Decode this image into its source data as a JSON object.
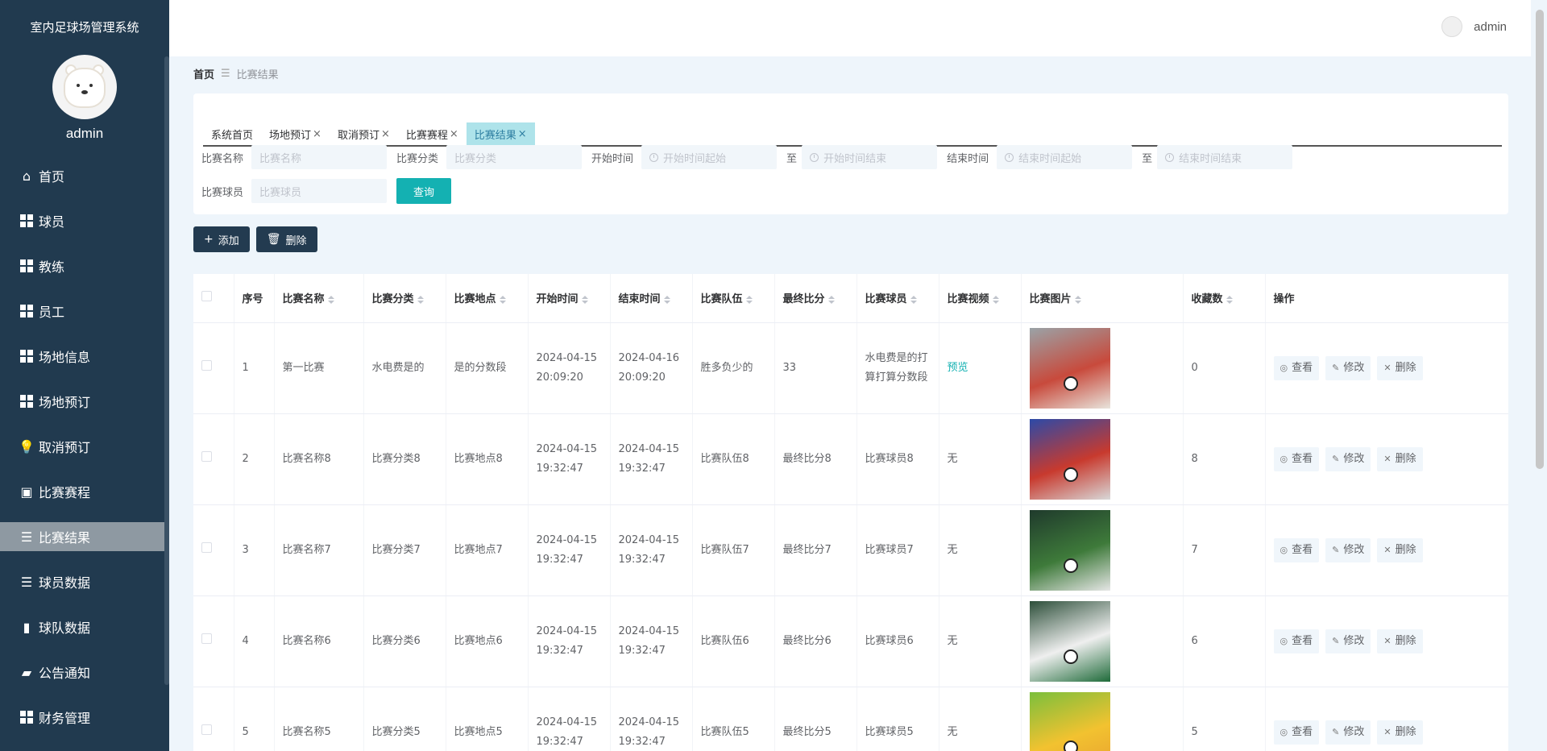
{
  "app": {
    "title": "室内足球场管理系统",
    "user": "admin"
  },
  "topbar": {
    "user": "admin"
  },
  "sidebar": {
    "items": [
      {
        "label": "首页",
        "icon": "home-icon"
      },
      {
        "label": "球员",
        "icon": "grid-icon"
      },
      {
        "label": "教练",
        "icon": "grid-icon"
      },
      {
        "label": "员工",
        "icon": "grid-icon"
      },
      {
        "label": "场地信息",
        "icon": "grid-icon"
      },
      {
        "label": "场地预订",
        "icon": "grid-icon"
      },
      {
        "label": "取消预订",
        "icon": "bulb-icon"
      },
      {
        "label": "比赛赛程",
        "icon": "wallet-icon"
      },
      {
        "label": "比赛结果",
        "icon": "sliders-icon",
        "active": true
      },
      {
        "label": "球员数据",
        "icon": "list-icon"
      },
      {
        "label": "球队数据",
        "icon": "bar-chart-icon"
      },
      {
        "label": "公告通知",
        "icon": "ticket-icon"
      },
      {
        "label": "财务管理",
        "icon": "grid-icon"
      }
    ]
  },
  "breadcrumb": {
    "home": "首页",
    "separator": "☰",
    "current": "比赛结果"
  },
  "tabs": [
    {
      "label": "系统首页",
      "closable": false
    },
    {
      "label": "场地预订",
      "closable": true
    },
    {
      "label": "取消预订",
      "closable": true
    },
    {
      "label": "比赛赛程",
      "closable": true
    },
    {
      "label": "比赛结果",
      "closable": true,
      "active": true
    }
  ],
  "filters": {
    "name_label": "比赛名称",
    "name_placeholder": "比赛名称",
    "category_label": "比赛分类",
    "category_placeholder": "比赛分类",
    "start_label": "开始时间",
    "start_from_placeholder": "开始时间起始",
    "start_to_placeholder": "开始时间结束",
    "end_label": "结束时间",
    "end_from_placeholder": "结束时间起始",
    "end_to_placeholder": "结束时间结束",
    "to": "至",
    "player_label": "比赛球员",
    "player_placeholder": "比赛球员",
    "query": "查询"
  },
  "actions": {
    "add": "添加",
    "delete": "删除"
  },
  "table": {
    "headers": [
      "序号",
      "比赛名称",
      "比赛分类",
      "比赛地点",
      "开始时间",
      "结束时间",
      "比赛队伍",
      "最终比分",
      "比赛球员",
      "比赛视频",
      "比赛图片",
      "收藏数",
      "操作"
    ],
    "op_labels": {
      "view": "查看",
      "edit": "修改",
      "delete": "删除"
    },
    "rows": [
      {
        "idx": "1",
        "name": "第一比赛",
        "category": "水电费是的",
        "place": "是的分数段",
        "start": "2024-04-15 20:09:20",
        "end": "2024-04-16 20:09:20",
        "team": "胜多负少的",
        "score": "33",
        "player": "水电费是的打算打算分数段",
        "video": "预览",
        "fav": "0",
        "img_palette": [
          "#9aa3a7",
          "#c84a3c",
          "#e8e4dc"
        ]
      },
      {
        "idx": "2",
        "name": "比赛名称8",
        "category": "比赛分类8",
        "place": "比赛地点8",
        "start": "2024-04-15 19:32:47",
        "end": "2024-04-15 19:32:47",
        "team": "比赛队伍8",
        "score": "最终比分8",
        "player": "比赛球员8",
        "video": "无",
        "fav": "8",
        "img_palette": [
          "#2c4aa8",
          "#c83a2e",
          "#d8d8d8"
        ]
      },
      {
        "idx": "3",
        "name": "比赛名称7",
        "category": "比赛分类7",
        "place": "比赛地点7",
        "start": "2024-04-15 19:32:47",
        "end": "2024-04-15 19:32:47",
        "team": "比赛队伍7",
        "score": "最终比分7",
        "player": "比赛球员7",
        "video": "无",
        "fav": "7",
        "img_palette": [
          "#1f3a2c",
          "#3e7a3a",
          "#e6e6e6"
        ]
      },
      {
        "idx": "4",
        "name": "比赛名称6",
        "category": "比赛分类6",
        "place": "比赛地点6",
        "start": "2024-04-15 19:32:47",
        "end": "2024-04-15 19:32:47",
        "team": "比赛队伍6",
        "score": "最终比分6",
        "player": "比赛球员6",
        "video": "无",
        "fav": "6",
        "img_palette": [
          "#2d4f3a",
          "#efefef",
          "#1f6b3a"
        ]
      },
      {
        "idx": "5",
        "name": "比赛名称5",
        "category": "比赛分类5",
        "place": "比赛地点5",
        "start": "2024-04-15 19:32:47",
        "end": "2024-04-15 19:32:47",
        "team": "比赛队伍5",
        "score": "最终比分5",
        "player": "比赛球员5",
        "video": "无",
        "fav": "5",
        "img_palette": [
          "#7bbf3c",
          "#f2c230",
          "#e8a030"
        ]
      }
    ]
  },
  "colors": {
    "sidebar_bg": "#213a4f",
    "accent": "#14b1b2",
    "dark_button": "#233b50",
    "active_tab": "#aee3ea"
  }
}
